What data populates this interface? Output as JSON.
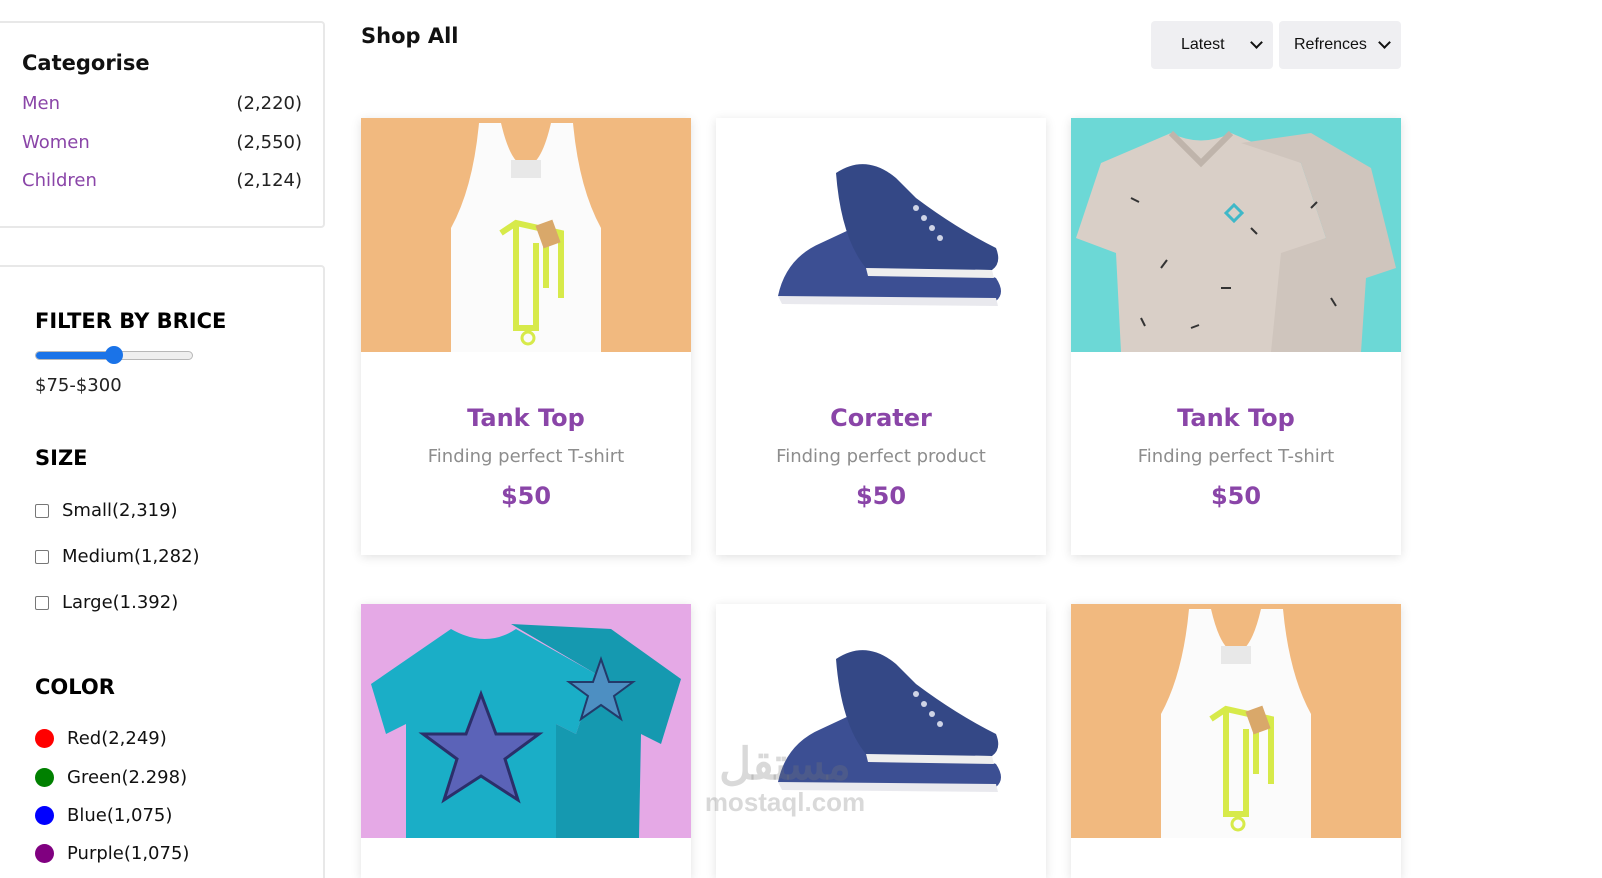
{
  "categories": {
    "title": "Categorise",
    "items": [
      {
        "label": "Men",
        "count": "(2,220)"
      },
      {
        "label": "Women",
        "count": "(2,550)"
      },
      {
        "label": "Children",
        "count": "(2,124)"
      }
    ]
  },
  "filters": {
    "price_title": "FILTER BY BRICE",
    "price_range": "$75-$300",
    "slider_value": 0.5,
    "size_title": "SIZE",
    "sizes": [
      "Small(2,319)",
      "Medium(1,282)",
      "Large(1.392)"
    ],
    "color_title": "COLOR",
    "colors": [
      {
        "label": "Red(2,249)",
        "color": "#ff0000"
      },
      {
        "label": "Green(2.298)",
        "color": "#008000"
      },
      {
        "label": "Blue(1,075)",
        "color": "#0000ff"
      },
      {
        "label": "Purple(1,075)",
        "color": "#800080"
      }
    ]
  },
  "shop": {
    "title": "Shop All",
    "sort_value": "Latest",
    "refs_value": "Refrences"
  },
  "products": [
    {
      "name": "Tank Top",
      "description": "Finding perfect T-shirt",
      "price": "$50",
      "image": "tank-top"
    },
    {
      "name": "Corater",
      "description": "Finding perfect product",
      "price": "$50",
      "image": "sneakers"
    },
    {
      "name": "Tank Top",
      "description": "Finding perfect T-shirt",
      "price": "$50",
      "image": "polo-shirt"
    },
    {
      "name": "",
      "description": "",
      "price": "",
      "image": "star-tshirt"
    },
    {
      "name": "",
      "description": "",
      "price": "",
      "image": "sneakers"
    },
    {
      "name": "",
      "description": "",
      "price": "",
      "image": "tank-top"
    }
  ],
  "watermark": {
    "arabic": "مستقل",
    "latin": "mostaql.com"
  }
}
